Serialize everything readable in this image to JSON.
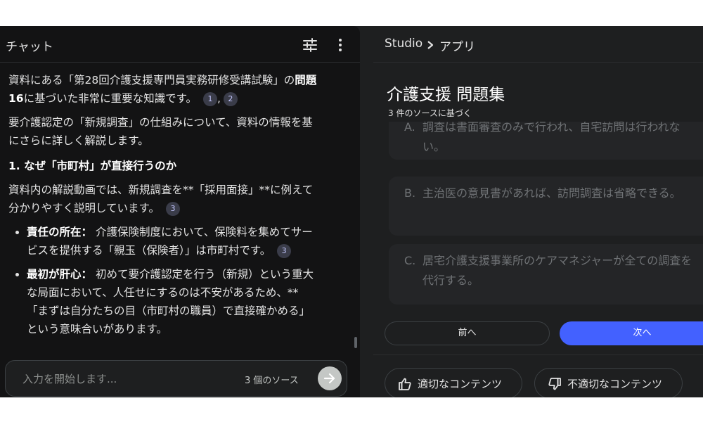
{
  "chat": {
    "title": "チャット",
    "paragraph1_a": "資料にある「第28回介護支援専門員実務研修受講試験」の",
    "paragraph1_bold": "問題16",
    "paragraph1_b": "に基づいた非常に重要な知識です。",
    "cite1": "1",
    "cite_sep": ",",
    "cite2": "2",
    "paragraph2": "要介護認定の「新規調査」の仕組みについて、資料の情報を基にさらに詳しく解説します。",
    "heading1": "1. なぜ「市町村」が直接行うのか",
    "paragraph3": "資料内の解説動画では、新規調査を**「採用面接」**に例えて分かりやすく説明しています。",
    "cite3": "3",
    "bullet1_bold": "責任の所在：",
    "bullet1_text": " 介護保険制度において、保険料を集めてサービスを提供する「親玉（保険者）」は市町村です。",
    "bullet1_cite": "3",
    "bullet2_bold": "最初が肝心：",
    "bullet2_text": " 初めて要介護認定を行う（新規）という重大な局面において、人任せにするのは不安があるため、**「まずは自分たちの目（市町村の職員）で直接確かめる」という意味合いがあります。",
    "input_placeholder": "入力を開始します...",
    "source_count": "3 個のソース"
  },
  "studio": {
    "breadcrumb_root": "Studio",
    "breadcrumb_leaf": "アプリ",
    "title": "介護支援 問題集",
    "subtitle": "3 件のソースに基づく",
    "option_a_label": "A.",
    "option_a_text": "調査は書面審査のみで行われ、自宅訪問は行われない。",
    "option_b_label": "B.",
    "option_b_text": "主治医の意見書があれば、訪問調査は省略できる。",
    "option_c_label": "C.",
    "option_c_text": "居宅介護支援事業所のケアマネジャーが全ての調査を代行する。",
    "prev_label": "前へ",
    "next_label": "次へ",
    "good_label": "適切なコンテンツ",
    "bad_label": "不適切なコンテンツ"
  },
  "icons": {
    "tune": "tune-icon",
    "more": "more-vert-icon",
    "chevron": "chevron-right-icon",
    "send": "arrow-right-icon",
    "thumb_up": "thumb-up-icon",
    "thumb_down": "thumb-down-icon"
  },
  "colors": {
    "background": "#1e1f20",
    "chat_background": "#131314",
    "accent": "#4361ff",
    "citation_bg": "#3a3c49"
  }
}
